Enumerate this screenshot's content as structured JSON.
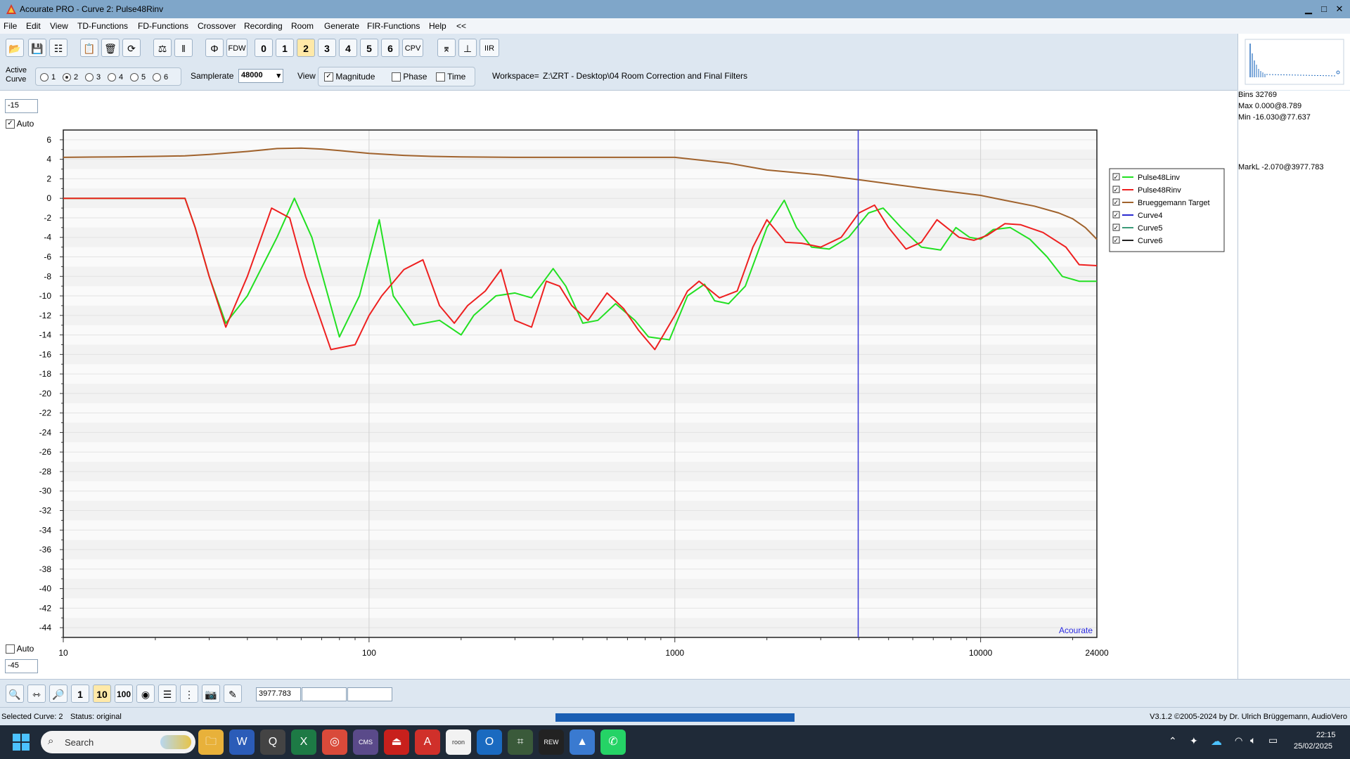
{
  "window": {
    "title": "Acourate PRO - Curve 2: Pulse48Rinv",
    "minimize": "▁",
    "maximize": "□",
    "close": "✕"
  },
  "menu": [
    "File",
    "Edit",
    "View",
    "TD-Functions",
    "FD-Functions",
    "Crossover",
    "Recording",
    "Room",
    "Generate",
    "FIR-Functions",
    "Help",
    "<<"
  ],
  "toolbar": {
    "buttons": [
      {
        "name": "open-icon",
        "glyph": "📂"
      },
      {
        "name": "save-icon",
        "glyph": "💾"
      },
      {
        "name": "tree-icon",
        "glyph": "☷"
      },
      {
        "name": "clipboard-icon",
        "glyph": "📋"
      },
      {
        "name": "trash-icon",
        "glyph": "🗑"
      },
      {
        "name": "rotate-icon",
        "glyph": "⟳"
      },
      {
        "name": "mixer-icon",
        "glyph": "⚖"
      },
      {
        "name": "tuning-icon",
        "glyph": "ǁ"
      },
      {
        "name": "phase-icon",
        "glyph": "Φ"
      },
      {
        "name": "fdw-button",
        "glyph": "FDW"
      },
      {
        "name": "curve-0-button",
        "glyph": "0"
      },
      {
        "name": "curve-1-button",
        "glyph": "1"
      },
      {
        "name": "curve-2-button",
        "glyph": "2"
      },
      {
        "name": "curve-3-button",
        "glyph": "3"
      },
      {
        "name": "curve-4-button",
        "glyph": "4"
      },
      {
        "name": "curve-5-button",
        "glyph": "5"
      },
      {
        "name": "curve-6-button",
        "glyph": "6"
      },
      {
        "name": "cpv-button",
        "glyph": "CPV"
      },
      {
        "name": "highpass-icon",
        "glyph": "⌆"
      },
      {
        "name": "impulse-icon",
        "glyph": "⊥"
      },
      {
        "name": "iir-button",
        "glyph": "IIR"
      }
    ]
  },
  "controls": {
    "active_curve_label": "Active Curve",
    "curves": [
      "1",
      "2",
      "3",
      "4",
      "5",
      "6"
    ],
    "active_curve": "2",
    "samplerate_label": "Samplerate",
    "samplerate": "48000",
    "view_label": "View",
    "view_options": [
      {
        "label": "Magnitude",
        "checked": true
      },
      {
        "label": "Phase",
        "checked": false
      },
      {
        "label": "Time",
        "checked": false
      }
    ],
    "workspace_label": "Workspace=",
    "workspace": "Z:\\ZRT - Desktop\\04 Room Correction and Final Filters"
  },
  "plot": {
    "y_max_field": "-15",
    "y_min_field": "-45",
    "auto_top_label": "Auto",
    "auto_top_checked": true,
    "auto_bottom_label": "Auto",
    "auto_bottom_checked": false,
    "watermark": "Acourate"
  },
  "chart_data": {
    "type": "line",
    "xscale": "log",
    "xlim": [
      10,
      24000
    ],
    "ylim": [
      -45,
      7
    ],
    "x_tick_labels": [
      "10",
      "100",
      "1000",
      "10000",
      "24000"
    ],
    "y_tick_labels": [
      "6",
      "4",
      "2",
      "0",
      "-2",
      "-4",
      "-6",
      "-8",
      "-10",
      "-12",
      "-14",
      "-16",
      "-18",
      "-20",
      "-22",
      "-24",
      "-26",
      "-28",
      "-30",
      "-32",
      "-34",
      "-36",
      "-38",
      "-40",
      "-42",
      "-44"
    ],
    "marker_x": 3977.783,
    "marker_color": "#3a3ad6",
    "series": [
      {
        "name": "Pulse48Linv",
        "color": "#22e022",
        "checked": true,
        "x": [
          10,
          25,
          27,
          30,
          34,
          40,
          50,
          57,
          65,
          80,
          93,
          108,
          120,
          140,
          170,
          200,
          220,
          260,
          300,
          340,
          400,
          440,
          500,
          560,
          640,
          740,
          820,
          960,
          1100,
          1250,
          1350,
          1500,
          1700,
          2000,
          2280,
          2500,
          2800,
          3200,
          3700,
          4300,
          4800,
          5500,
          6400,
          7400,
          8300,
          9200,
          10000,
          11000,
          12500,
          14500,
          16500,
          18500,
          21000,
          24000
        ],
        "y": [
          0,
          0,
          -3,
          -8,
          -12.8,
          -10,
          -4,
          0,
          -4,
          -14.2,
          -10,
          -2.2,
          -10,
          -13,
          -12.5,
          -14,
          -12,
          -10,
          -9.7,
          -10.2,
          -7.2,
          -9,
          -12.8,
          -12.5,
          -10.8,
          -12.5,
          -14.2,
          -14.5,
          -10,
          -8.8,
          -10.5,
          -10.8,
          -9,
          -3,
          -0.2,
          -3,
          -5,
          -5.2,
          -4,
          -1.5,
          -1,
          -3,
          -5,
          -5.3,
          -3,
          -4,
          -4.2,
          -3.2,
          -3,
          -4.2,
          -6,
          -8,
          -8.5,
          -8.5
        ]
      },
      {
        "name": "Pulse48Rinv",
        "color": "#ee2020",
        "checked": true,
        "x": [
          10,
          25,
          27,
          30,
          34,
          40,
          48,
          55,
          62,
          75,
          90,
          100,
          110,
          130,
          150,
          170,
          190,
          210,
          240,
          270,
          300,
          340,
          380,
          420,
          460,
          520,
          600,
          680,
          760,
          860,
          1000,
          1100,
          1200,
          1400,
          1600,
          1800,
          2000,
          2300,
          2600,
          3000,
          3500,
          4000,
          4500,
          5000,
          5700,
          6400,
          7200,
          8500,
          9500,
          10500,
          12000,
          13500,
          16000,
          19000,
          21000,
          24000
        ],
        "y": [
          0,
          0,
          -3,
          -8,
          -13.2,
          -8,
          -1,
          -2,
          -8,
          -15.5,
          -15,
          -12,
          -10,
          -7.3,
          -6.3,
          -11,
          -12.8,
          -11,
          -9.5,
          -7.3,
          -12.5,
          -13.2,
          -8.5,
          -9,
          -11,
          -12.5,
          -9.7,
          -11.3,
          -13.5,
          -15.5,
          -12,
          -9.5,
          -8.5,
          -10.2,
          -9.5,
          -5,
          -2.2,
          -4.5,
          -4.6,
          -5,
          -4,
          -1.5,
          -0.7,
          -3,
          -5.2,
          -4.5,
          -2.2,
          -4,
          -4.3,
          -3.8,
          -2.6,
          -2.7,
          -3.5,
          -5,
          -6.8,
          -6.9
        ]
      },
      {
        "name": "Brueggemann Target",
        "color": "#a0622c",
        "checked": true,
        "x": [
          10,
          15,
          20,
          25,
          30,
          40,
          50,
          60,
          70,
          80,
          100,
          130,
          160,
          200,
          300,
          500,
          700,
          1000,
          1500,
          2000,
          3000,
          4000,
          5000,
          7000,
          10000,
          12000,
          15000,
          18000,
          20000,
          22000,
          24000
        ],
        "y": [
          4.2,
          4.25,
          4.3,
          4.35,
          4.5,
          4.8,
          5.1,
          5.15,
          5.05,
          4.9,
          4.6,
          4.4,
          4.3,
          4.25,
          4.2,
          4.2,
          4.2,
          4.2,
          3.6,
          2.9,
          2.4,
          1.9,
          1.5,
          0.9,
          0.3,
          -0.2,
          -0.8,
          -1.5,
          -2.1,
          -3,
          -4.2
        ]
      },
      {
        "name": "Curve4",
        "color": "#2a2ad0",
        "checked": true,
        "x": [],
        "y": []
      },
      {
        "name": "Curve5",
        "color": "#3a9a78",
        "checked": true,
        "x": [],
        "y": []
      },
      {
        "name": "Curve6",
        "color": "#222222",
        "checked": true,
        "x": [],
        "y": []
      }
    ]
  },
  "info": {
    "bins": "Bins 32769",
    "max": "Max 0.000@8.789",
    "min": "Min -16.030@77.637",
    "mark": "MarkL -2.070@3977.783"
  },
  "bottom": {
    "buttons": [
      {
        "name": "zoom-in-icon",
        "glyph": "🔍"
      },
      {
        "name": "fit-width-icon",
        "glyph": "⇿"
      },
      {
        "name": "zoom-out-icon",
        "glyph": "🔎"
      },
      {
        "name": "scale-1-button",
        "glyph": "1"
      },
      {
        "name": "scale-10-button",
        "glyph": "10"
      },
      {
        "name": "scale-100-button",
        "glyph": "100"
      },
      {
        "name": "target-icon",
        "glyph": "◉"
      },
      {
        "name": "lines-icon",
        "glyph": "☰"
      },
      {
        "name": "grid-icon",
        "glyph": "⋮"
      },
      {
        "name": "camera-icon",
        "glyph": "📷"
      },
      {
        "name": "edit-icon",
        "glyph": "✎"
      }
    ],
    "field1": "3977.783",
    "field2": "",
    "field3": ""
  },
  "status": {
    "selected": "Selected Curve: 2",
    "state": "Status: original",
    "progress": 1.0,
    "version": "V3.1.2 ©2005-2024 by Dr. Ulrich Brüggemann, AudioVero"
  },
  "taskbar": {
    "search_placeholder": "Search",
    "apps": [
      {
        "name": "file-explorer-icon",
        "glyph": "🗀",
        "bg": "#e8b13a"
      },
      {
        "name": "word-icon",
        "glyph": "W",
        "bg": "#2b5cb8"
      },
      {
        "name": "magnifier-app-icon",
        "glyph": "Q",
        "bg": "#444"
      },
      {
        "name": "excel-icon",
        "glyph": "X",
        "bg": "#1d7a45"
      },
      {
        "name": "chrome-icon",
        "glyph": "◎",
        "bg": "#d94a3a"
      },
      {
        "name": "cms-icon",
        "glyph": "CMS",
        "bg": "#5a4a8a"
      },
      {
        "name": "acrobat-icon",
        "glyph": "⏏",
        "bg": "#c8201c"
      },
      {
        "name": "acourate-icon",
        "glyph": "A",
        "bg": "#d0302a"
      },
      {
        "name": "roon-icon",
        "glyph": "roon",
        "bg": "#f2f2f2"
      },
      {
        "name": "outlook-icon",
        "glyph": "O",
        "bg": "#1a6ac0"
      },
      {
        "name": "analyzer-icon",
        "glyph": "⌗",
        "bg": "#3a5a3a"
      },
      {
        "name": "rew-icon",
        "glyph": "REW",
        "bg": "#222"
      },
      {
        "name": "photos-icon",
        "glyph": "▲",
        "bg": "#3a7ad0"
      },
      {
        "name": "whatsapp-icon",
        "glyph": "✆",
        "bg": "#25d366"
      }
    ],
    "time": "22:15",
    "date": "25/02/2025"
  }
}
